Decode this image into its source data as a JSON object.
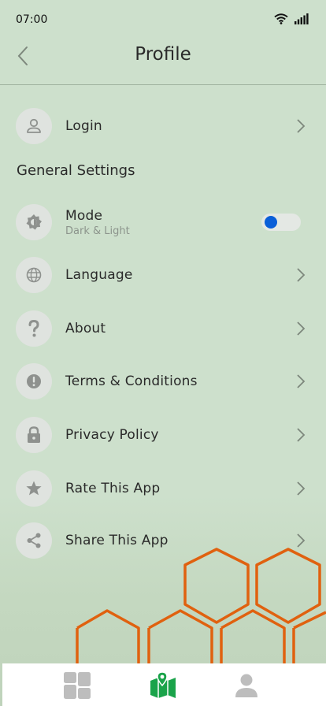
{
  "status": {
    "time": "07:00"
  },
  "header": {
    "title": "Profile"
  },
  "login": {
    "label": "Login"
  },
  "section_title": "General Settings",
  "settings": {
    "mode": {
      "label": "Mode",
      "sublabel": "Dark & Light",
      "toggle_color": "#0a5fd8"
    },
    "language": "Language",
    "about": "About",
    "terms": "Terms & Conditions",
    "privacy": "Privacy Policy",
    "rate": "Rate This App",
    "share": "Share This App"
  },
  "colors": {
    "accent_orange": "#e0610f",
    "nav_active": "#1aa34a",
    "nav_inactive": "#bdbdbd",
    "icon_gray": "#8e918e"
  },
  "bottom_nav": {
    "items": [
      {
        "icon": "dashboard-icon",
        "active": false
      },
      {
        "icon": "map-pin-icon",
        "active": true
      },
      {
        "icon": "user-icon",
        "active": false
      }
    ]
  }
}
